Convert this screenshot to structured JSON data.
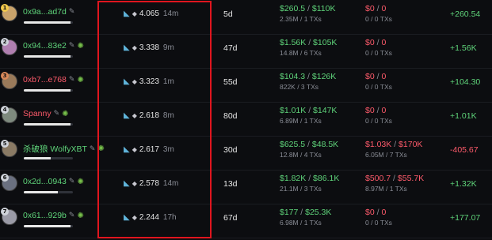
{
  "rows": [
    {
      "rank": "1",
      "rank_color": "#f2c94c",
      "avatar_color": "#c9a36b",
      "name": "0x9a...ad7d",
      "name_color": "green",
      "has_bug": false,
      "bar_fill": 0.95,
      "buy_val": "4.065",
      "buy_time": "14m",
      "age": "5d",
      "bought_main": "$260.5",
      "bought_total": "$110K",
      "bought_sub": "2.35M / 1 TXs",
      "sold_main": "$0",
      "sold_total": "0",
      "sold_sub": "0 / 0 TXs",
      "pnl": "+260.54",
      "pnl_sign": "pos"
    },
    {
      "rank": "2",
      "rank_color": "#cfd3da",
      "avatar_color": "#b07fb0",
      "name": "0x94...83e2",
      "name_color": "green",
      "has_bug": true,
      "bar_fill": 0.95,
      "buy_val": "3.338",
      "buy_time": "9m",
      "age": "47d",
      "bought_main": "$1.56K",
      "bought_total": "$105K",
      "bought_sub": "14.8M / 6 TXs",
      "sold_main": "$0",
      "sold_total": "0",
      "sold_sub": "0 / 0 TXs",
      "pnl": "+1.56K",
      "pnl_sign": "pos"
    },
    {
      "rank": "3",
      "rank_color": "#d9895a",
      "avatar_color": "#9a7a5a",
      "name": "0xb7...e768",
      "name_color": "red",
      "has_bug": true,
      "bar_fill": 0.95,
      "buy_val": "3.323",
      "buy_time": "1m",
      "age": "55d",
      "bought_main": "$104.3",
      "bought_total": "$126K",
      "bought_sub": "822K / 3 TXs",
      "sold_main": "$0",
      "sold_total": "0",
      "sold_sub": "0 / 0 TXs",
      "pnl": "+104.30",
      "pnl_sign": "pos"
    },
    {
      "rank": "4",
      "rank_color": "#cfd3da",
      "avatar_color": "#7e8a7e",
      "name": "Spanny",
      "name_color": "red",
      "has_bug": true,
      "bar_fill": 0.95,
      "buy_val": "2.618",
      "buy_time": "8m",
      "age": "80d",
      "bought_main": "$1.01K",
      "bought_total": "$147K",
      "bought_sub": "6.89M / 1 TXs",
      "sold_main": "$0",
      "sold_total": "0",
      "sold_sub": "0 / 0 TXs",
      "pnl": "+1.01K",
      "pnl_sign": "pos"
    },
    {
      "rank": "5",
      "rank_color": "#cfd3da",
      "avatar_color": "#8a7a64",
      "name": "杀破狼 WolfyXBT",
      "name_color": "green",
      "has_bug": true,
      "bar_fill": 0.55,
      "buy_val": "2.617",
      "buy_time": "3m",
      "age": "30d",
      "bought_main": "$625.5",
      "bought_total": "$48.5K",
      "bought_sub": "12.8M / 4 TXs",
      "sold_main": "$1.03K",
      "sold_total": "$170K",
      "sold_sub": "6.05M / 7 TXs",
      "pnl": "-405.67",
      "pnl_sign": "neg"
    },
    {
      "rank": "6",
      "rank_color": "#cfd3da",
      "avatar_color": "#6a7080",
      "name": "0x2d...0943",
      "name_color": "green",
      "has_bug": true,
      "bar_fill": 0.7,
      "buy_val": "2.578",
      "buy_time": "14m",
      "age": "13d",
      "bought_main": "$1.82K",
      "bought_total": "$86.1K",
      "bought_sub": "21.1M / 3 TXs",
      "sold_main": "$500.7",
      "sold_total": "$55.7K",
      "sold_sub": "8.97M / 1 TXs",
      "pnl": "+1.32K",
      "pnl_sign": "pos"
    },
    {
      "rank": "7",
      "rank_color": "#cfd3da",
      "avatar_color": "#9a9aa6",
      "name": "0x61...929b",
      "name_color": "green",
      "has_bug": true,
      "bar_fill": 0.95,
      "buy_val": "2.244",
      "buy_time": "17h",
      "age": "67d",
      "bought_main": "$177",
      "bought_total": "$25.3K",
      "bought_sub": "6.98M / 1 TXs",
      "sold_main": "$0",
      "sold_total": "0",
      "sold_sub": "0 / 0 TXs",
      "pnl": "+177.07",
      "pnl_sign": "pos"
    }
  ],
  "icons": {
    "edit": "edit-icon",
    "bug": "bug-icon",
    "dolphin": "dolphin-icon",
    "eth": "eth-icon"
  },
  "colors": {
    "green": "#5fd47a",
    "red": "#ff5b6b",
    "highlight": "#e0151e"
  }
}
